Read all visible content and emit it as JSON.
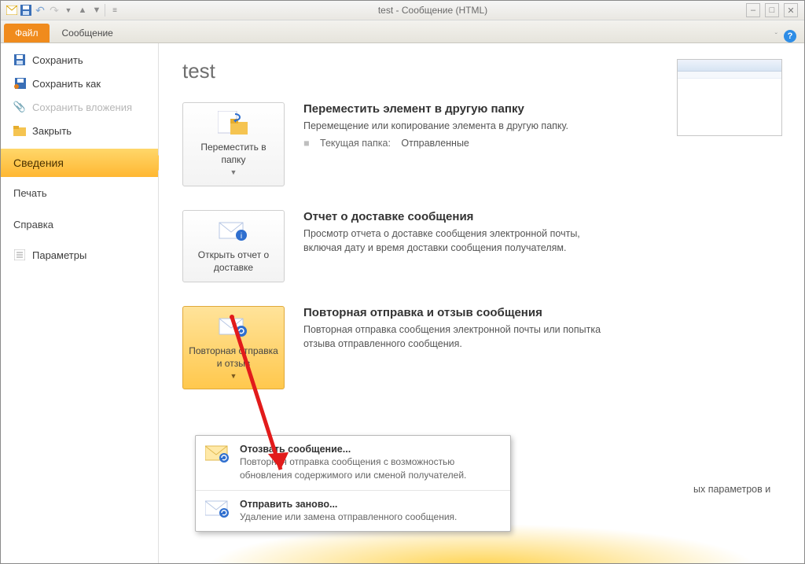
{
  "window": {
    "title": "test - Сообщение (HTML)"
  },
  "ribbon": {
    "file_tab": "Файл",
    "message_tab": "Сообщение"
  },
  "sidebar": {
    "save": "Сохранить",
    "save_as": "Сохранить как",
    "save_attachments": "Сохранить вложения",
    "close": "Закрыть",
    "info": "Сведения",
    "print": "Печать",
    "help": "Справка",
    "options": "Параметры"
  },
  "main": {
    "title": "test",
    "section1": {
      "button": "Переместить в папку",
      "heading": "Переместить элемент в другую папку",
      "desc": "Перемещение или копирование элемента в другую папку.",
      "meta_label": "Текущая папка:",
      "meta_value": "Отправленные"
    },
    "section2": {
      "button": "Открыть отчет о доставке",
      "heading": "Отчет о доставке сообщения",
      "desc": "Просмотр отчета о доставке сообщения электронной почты, включая дату и время доставки сообщения получателям."
    },
    "section3": {
      "button": "Повторная отправка и отзыв",
      "heading": "Повторная отправка и отзыв сообщения",
      "desc": "Повторная отправка сообщения электронной почты или попытка отзыва отправленного сообщения.",
      "truncated_tail": "ых параметров и"
    }
  },
  "dropdown": {
    "item1_title": "Отозвать сообщение...",
    "item1_desc": "Повторная отправка сообщения с возможностью обновления содержимого или сменой получателей.",
    "item2_title": "Отправить заново...",
    "item2_desc": "Удаление или замена отправленного сообщения."
  }
}
